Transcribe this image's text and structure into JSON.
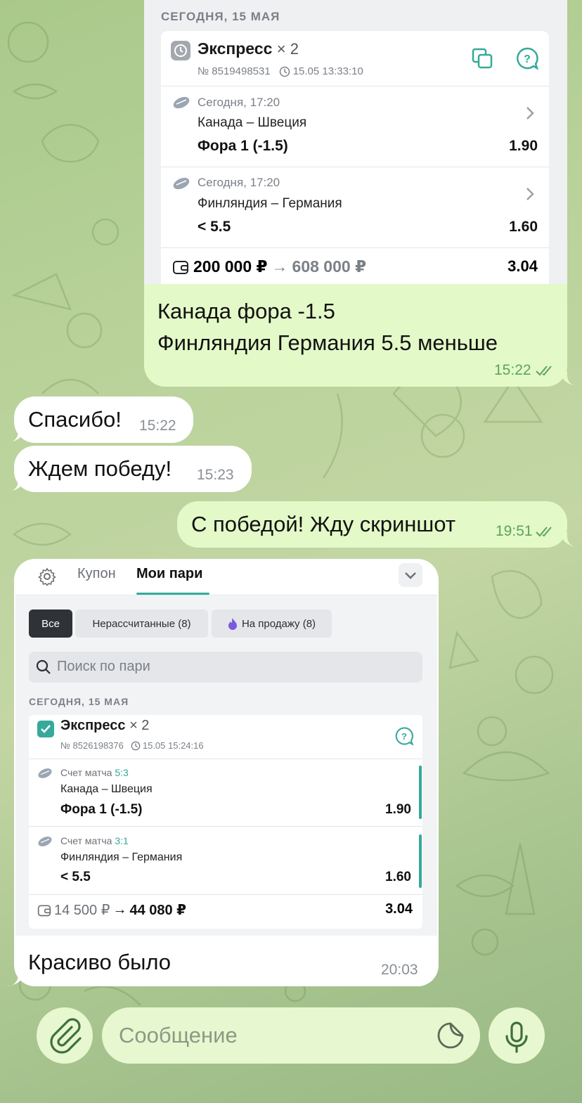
{
  "colors": {
    "outgoing_bubble": "#e3f9c8",
    "incoming_bubble": "#ffffff",
    "accent_teal": "#35a99b",
    "time_green": "#5fa35a"
  },
  "message1": {
    "embed": {
      "date_header": "СЕГОДНЯ, 15 МАЯ",
      "title": "Экспресс",
      "multiplier": "× 2",
      "number": "№ 8519498531",
      "timestamp": "15.05 13:33:10",
      "legs": [
        {
          "when": "Сегодня, 17:20",
          "match": "Канада – Швеция",
          "bet": "Фора 1 (-1.5)",
          "odd": "1.90"
        },
        {
          "when": "Сегодня, 17:20",
          "match": "Финляндия – Германия",
          "bet": "< 5.5",
          "odd": "1.60"
        }
      ],
      "stake": "200 000 ₽",
      "arrow": "→",
      "payout": "608 000 ₽",
      "total_odd": "3.04"
    },
    "line1": "Канада фора -1.5",
    "line2": "Финляндия Германия 5.5 меньше",
    "time": "15:22"
  },
  "message2": {
    "text": "Спасибо!",
    "time": "15:22"
  },
  "message3": {
    "text": "Ждем победу!",
    "time": "15:23"
  },
  "message4": {
    "text": "С победой! Жду скриншот",
    "time": "19:51"
  },
  "message5": {
    "embed": {
      "tab_coupon": "Купон",
      "tab_my_bets": "Мои пари",
      "filter_all": "Все",
      "filter_unsettled": "Нерассчитанные (8)",
      "filter_for_sale": "На продажу (8)",
      "search_placeholder": "Поиск по пари",
      "date_header": "СЕГОДНЯ, 15 МАЯ",
      "title": "Экспресс",
      "multiplier": "× 2",
      "number": "№ 8526198376",
      "timestamp": "15.05 15:24:16",
      "legs": [
        {
          "score_label": "Счет матча",
          "score": "5:3",
          "match": "Канада – Швеция",
          "bet": "Фора 1 (-1.5)",
          "odd": "1.90"
        },
        {
          "score_label": "Счет матча",
          "score": "3:1",
          "match": "Финляндия – Германия",
          "bet": "< 5.5",
          "odd": "1.60"
        }
      ],
      "stake": "14 500 ₽",
      "arrow": "→",
      "payout": "44 080 ₽",
      "total_odd": "3.04"
    },
    "text": "Красиво было",
    "time": "20:03"
  },
  "composer": {
    "placeholder": "Сообщение"
  },
  "icons": [
    "attach-icon",
    "sticker-icon",
    "mic-icon",
    "copy-icon",
    "help-icon",
    "gear-icon",
    "search-icon",
    "chevron-down-icon",
    "fire-icon",
    "wallet-icon",
    "clock-icon",
    "hockey-puck-icon",
    "read-ticks-icon"
  ]
}
